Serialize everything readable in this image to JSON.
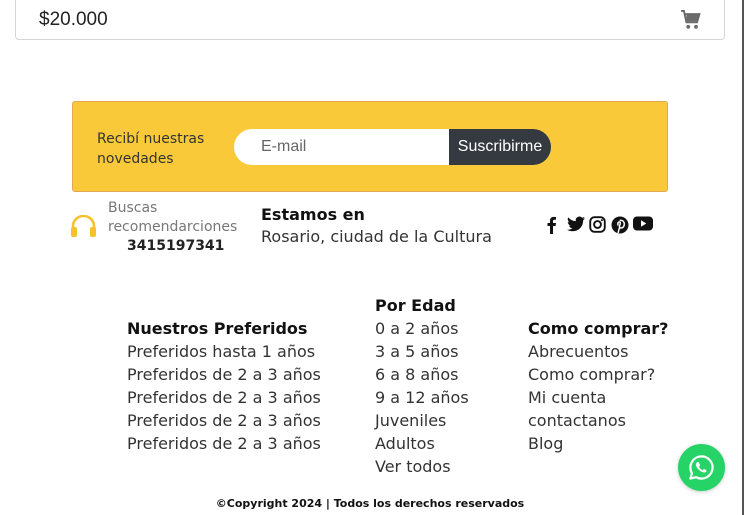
{
  "product": {
    "price": "$20.000",
    "cart_icon": "cart-icon"
  },
  "newsletter": {
    "label": "Recibí nuestras novedades",
    "email_placeholder": "E-mail",
    "subscribe_label": "Suscribirme",
    "background": "#f9c93a"
  },
  "contact": {
    "line1": "Buscas",
    "line2": "recomendarciones",
    "phone": "3415197341",
    "icon": "headphones-icon",
    "icon_color": "#f6c12c"
  },
  "location": {
    "title": "Estamos en",
    "text": "Rosario, ciudad de la Cultura"
  },
  "social": [
    "facebook-icon",
    "twitter-icon",
    "instagram-icon",
    "pinterest-icon",
    "youtube-icon"
  ],
  "footer": {
    "preferidos": {
      "title": "Nuestros Preferidos",
      "items": [
        "Preferidos hasta 1 años",
        "Preferidos de 2 a 3 años",
        "Preferidos de 2 a 3 años",
        "Preferidos de 2 a 3 años",
        "Preferidos de 2 a 3 años"
      ]
    },
    "por_edad": {
      "title": "Por Edad",
      "items": [
        "0 a 2 años",
        "3 a 5 años",
        "6 a 8 años",
        "9 a 12 años",
        "Juveniles",
        "Adultos",
        "Ver todos"
      ]
    },
    "como_comprar": {
      "title": "Como comprar?",
      "items": [
        "Abrecuentos",
        "Como comprar?",
        "Mi cuenta",
        "contactanos",
        "Blog"
      ]
    },
    "copyright": "©Copyright 2024 | Todos los derechos reservados"
  },
  "whatsapp": {
    "icon": "whatsapp-icon",
    "color": "#25d366"
  }
}
